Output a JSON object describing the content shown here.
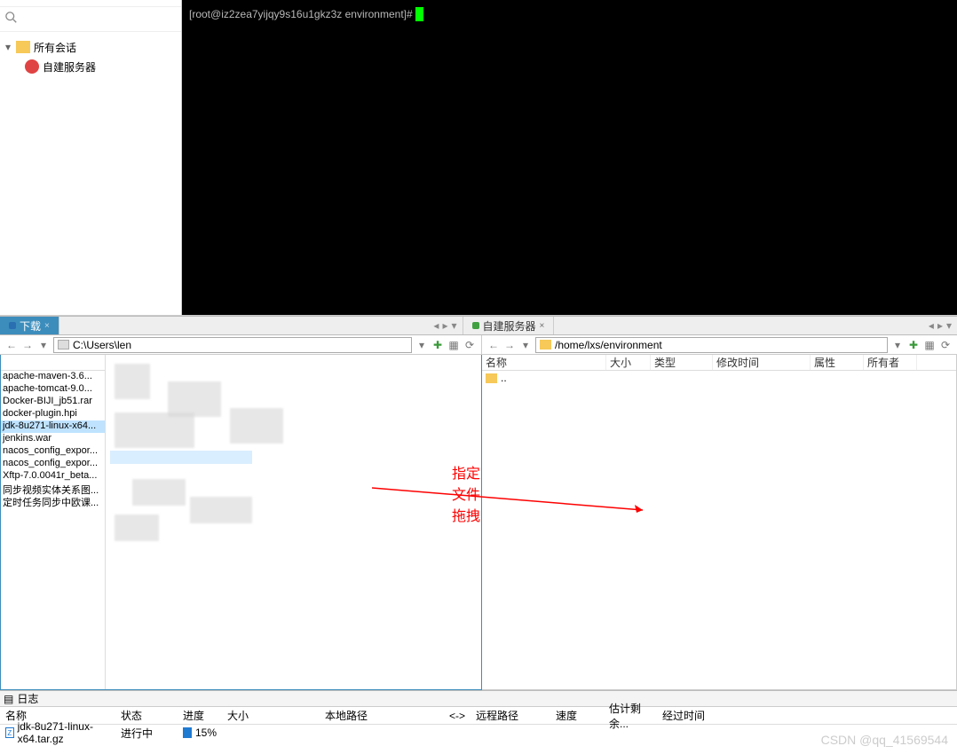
{
  "session_tree": {
    "root_label": "所有会话",
    "child_label": "自建服务器",
    "search_placeholder": ""
  },
  "terminal": {
    "prompt": "[root@iz2zea7yijqy9s16u1gkz3z environment]# "
  },
  "tabs": {
    "local": {
      "label": "下载"
    },
    "remote": {
      "label": "自建服务器"
    }
  },
  "paths": {
    "local": "C:\\Users\\len",
    "remote": "/home/lxs/environment"
  },
  "local_files": [
    "apache-maven-3.6...",
    "apache-tomcat-9.0...",
    "Docker-BIJI_jb51.rar",
    "docker-plugin.hpi",
    "jdk-8u271-linux-x64...",
    "jenkins.war",
    "nacos_config_expor...",
    "nacos_config_expor...",
    "Xftp-7.0.0041r_beta...",
    "同步视频实体关系图...",
    "定时任务同步中欧课..."
  ],
  "local_selected_index": 4,
  "remote_headers": {
    "name": "名称",
    "size": "大小",
    "type": "类型",
    "mtime": "修改时间",
    "attr": "属性",
    "owner": "所有者"
  },
  "remote_rows": [
    {
      "name": ".."
    }
  ],
  "annotation": "指定文件拖拽",
  "log": {
    "title": "日志",
    "headers": {
      "name": "名称",
      "status": "状态",
      "progress": "进度",
      "size": "大小",
      "local_path": "本地路径",
      "arrows": "<->",
      "remote_path": "远程路径",
      "speed": "速度",
      "remaining": "估计剩余...",
      "elapsed": "经过时间"
    },
    "row": {
      "name": "jdk-8u271-linux-x64.tar.gz",
      "status": "进行中",
      "progress": "15%"
    }
  },
  "watermark": "CSDN @qq_41569544"
}
